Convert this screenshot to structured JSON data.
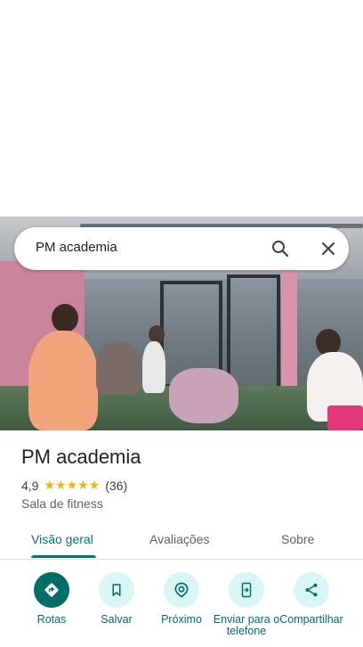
{
  "search": {
    "query": "PM academia"
  },
  "place": {
    "name": "PM academia",
    "rating": "4,9",
    "stars": "★★★★★",
    "review_count": "(36)",
    "category": "Sala de fitness"
  },
  "tabs": [
    {
      "label": "Visão geral",
      "active": true
    },
    {
      "label": "Avaliações",
      "active": false
    },
    {
      "label": "Sobre",
      "active": false
    }
  ],
  "actions": [
    {
      "label": "Rotas",
      "icon": "directions-icon"
    },
    {
      "label": "Salvar",
      "icon": "bookmark-icon"
    },
    {
      "label": "Próximo",
      "icon": "nearby-icon"
    },
    {
      "label": "Enviar para o telefone",
      "icon": "send-to-phone-icon"
    },
    {
      "label": "Compartilhar",
      "icon": "share-icon"
    }
  ],
  "colors": {
    "accent": "#006e66",
    "stars": "#f4b400",
    "action_bg": "#d9f6f4"
  }
}
